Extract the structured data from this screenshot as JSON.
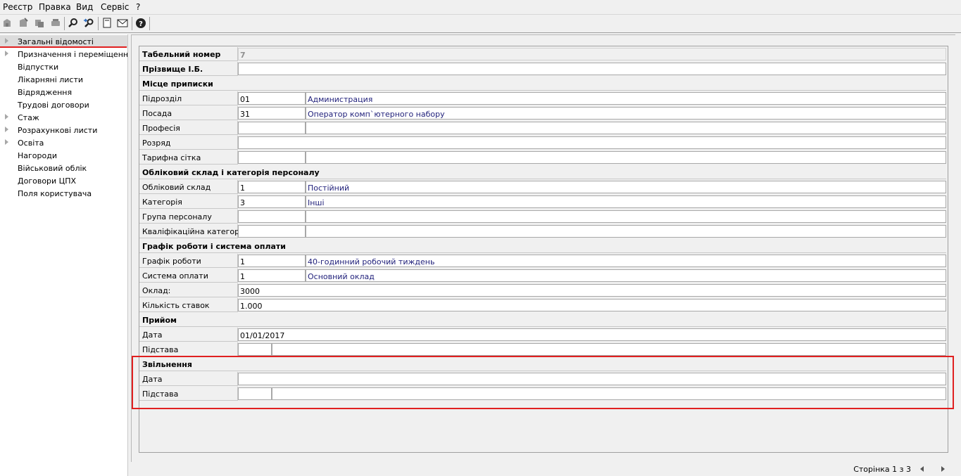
{
  "menu": [
    "Реєстр",
    "Правка",
    "Вид",
    "Сервіс",
    "?"
  ],
  "toolbar": {
    "icons": [
      "add-record-icon",
      "edit-record-icon",
      "copy-record-icon",
      "delete-record-icon",
      "search-icon",
      "search-next-icon",
      "document-icon",
      "mail-icon",
      "help-icon"
    ]
  },
  "sidebar": {
    "items": [
      {
        "label": "Загальні відомості",
        "expandable": true,
        "selected": true
      },
      {
        "label": "Призначення і переміщення",
        "expandable": true
      },
      {
        "label": "Відпустки",
        "expandable": false
      },
      {
        "label": "Лікарняні листи",
        "expandable": false
      },
      {
        "label": "Відрядження",
        "expandable": false
      },
      {
        "label": "Трудові договори",
        "expandable": false
      },
      {
        "label": "Стаж",
        "expandable": true
      },
      {
        "label": "Розрахункові листи",
        "expandable": true
      },
      {
        "label": "Освіта",
        "expandable": true
      },
      {
        "label": "Нагороди",
        "expandable": false
      },
      {
        "label": "Військовий облік",
        "expandable": false
      },
      {
        "label": "Договори ЦПХ",
        "expandable": false
      },
      {
        "label": "Поля користувача",
        "expandable": false
      }
    ]
  },
  "form": {
    "tab_number": {
      "label": "Табельний номер",
      "value": "7"
    },
    "name": {
      "label": "Прізвище І.Б.",
      "value": ""
    },
    "place_header": "Місце приписки",
    "department": {
      "label": "Підрозділ",
      "code": "01",
      "name": "Администрация"
    },
    "position": {
      "label": "Посада",
      "code": "31",
      "name": "Оператор комп`ютерного набору"
    },
    "profession": {
      "label": "Професія",
      "code": "",
      "name": ""
    },
    "grade": {
      "label": "Розряд",
      "value": ""
    },
    "tariff": {
      "label": "Тарифна сітка",
      "code": "",
      "name": ""
    },
    "staff_header": "Обліковий склад і категорія персоналу",
    "staff": {
      "label": "Обліковий склад",
      "code": "1",
      "name": "Постійний"
    },
    "category": {
      "label": "Категорія",
      "code": "3",
      "name": "Інші"
    },
    "group": {
      "label": "Група персоналу",
      "code": "",
      "name": ""
    },
    "qualification": {
      "label": "Кваліфікаційна категорія",
      "code": "",
      "name": ""
    },
    "schedule_header": "Графік роботи і система оплати",
    "schedule": {
      "label": "Графік роботи",
      "code": "1",
      "name": "40-годинний робочий тиждень"
    },
    "pay_system": {
      "label": "Система оплати",
      "code": "1",
      "name": "Основний оклад"
    },
    "salary": {
      "label": "Оклад:",
      "value": "3000"
    },
    "rates": {
      "label": "Кількість ставок",
      "value": "1.000"
    },
    "hire_header": "Прийом",
    "hire_date": {
      "label": "Дата",
      "value": "01/01/2017"
    },
    "hire_basis": {
      "label": "Підстава",
      "code": "",
      "name": ""
    },
    "dismiss_header": "Звільнення",
    "dismiss_date": {
      "label": "Дата",
      "value": ""
    },
    "dismiss_basis": {
      "label": "Підстава",
      "code": "",
      "name": ""
    }
  },
  "status": {
    "page": "Сторінка 1 з 3"
  },
  "colors": {
    "highlight": "#e02020",
    "selection": "#dcdcdc"
  }
}
